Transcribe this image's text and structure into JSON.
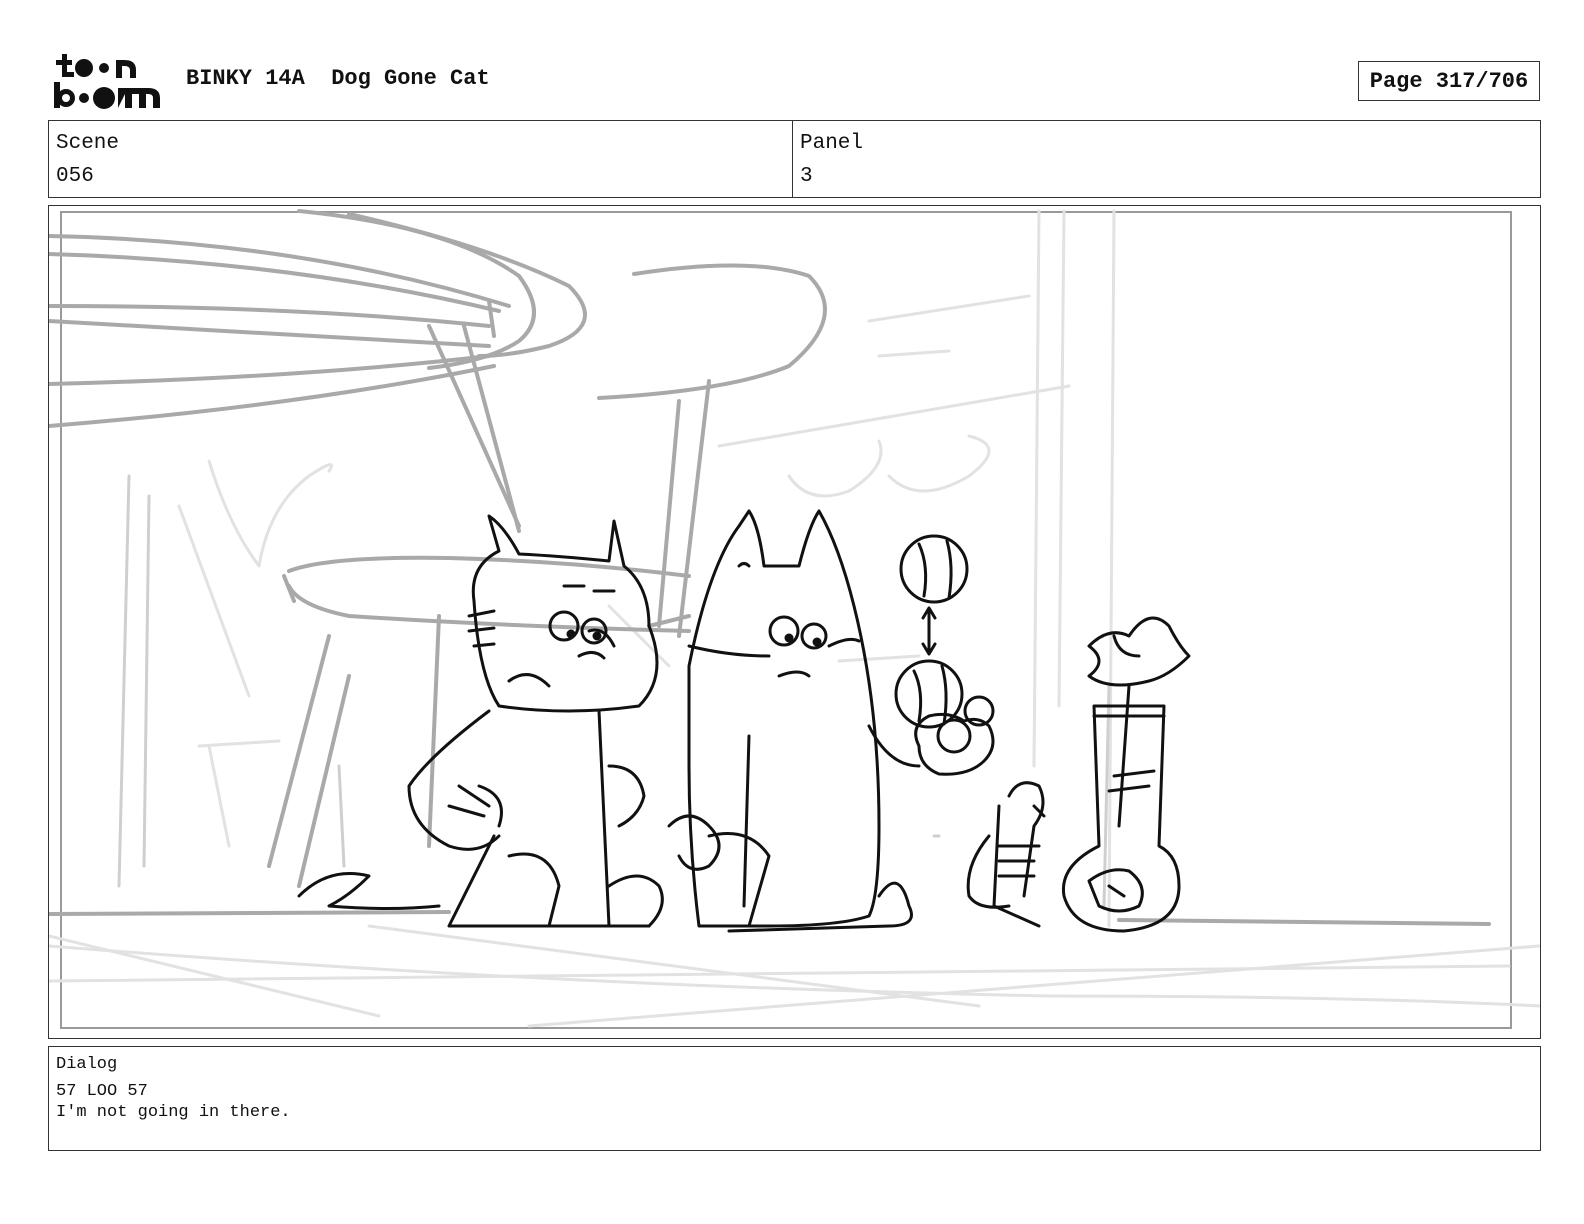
{
  "header": {
    "logo_text_top": "toon",
    "logo_text_bottom": "boom",
    "show_title": "BINKY 14A  Dog Gone Cat",
    "page": "Page 317/706"
  },
  "info": {
    "scene_label": "Scene",
    "scene_value": "056",
    "panel_label": "Panel",
    "panel_value": "3"
  },
  "artwork": {
    "description_icon": "storyboard-sketch-icon"
  },
  "dialog": {
    "label": "Dialog",
    "line1": "57 LOO 57",
    "line2": "I'm not going in there."
  }
}
